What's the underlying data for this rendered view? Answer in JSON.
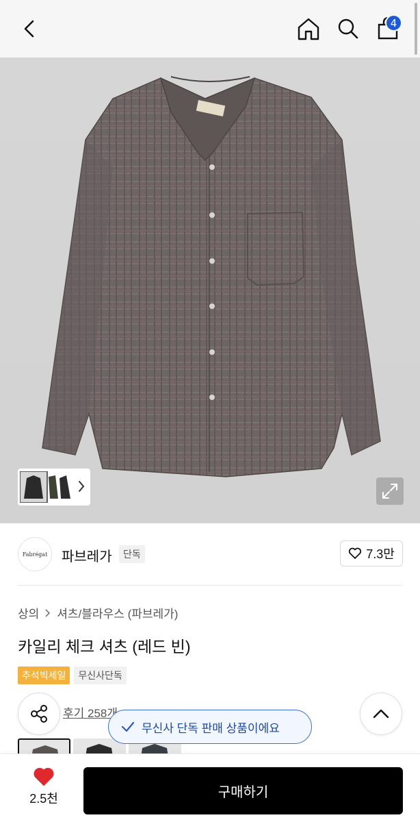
{
  "header": {
    "cart_count": "4",
    "icons": [
      "back-chevron-icon",
      "home-icon",
      "search-icon",
      "cart-icon"
    ]
  },
  "gallery": {
    "image_name": "shirt-product-image",
    "thumbnail_strip_icon": "chevron-right-icon",
    "expand_icon": "expand-icon"
  },
  "brand": {
    "logo_text": "Fabrégat",
    "name": "파브레가",
    "tag": "단독",
    "likes": "7.3만"
  },
  "breadcrumb": {
    "category": "상의",
    "separator": ">",
    "subcategory": "셔츠/블라우스 (파브레가)"
  },
  "product": {
    "title": "카일리 체크 셔츠 (레드 빈)",
    "tag_sale": "추석빅세일",
    "tag_exclusive": "무신사단독",
    "review_text": "후기 258개"
  },
  "toast": {
    "text": "무신사 단독 판매 상품이에요"
  },
  "bottom": {
    "wish_count": "2.5천",
    "buy_label": "구매하기"
  },
  "colors": {
    "accent_blue": "#1d5bd6",
    "sale_orange": "#f4b23c",
    "wish_red": "#e0292c",
    "buy_black": "#000000"
  }
}
